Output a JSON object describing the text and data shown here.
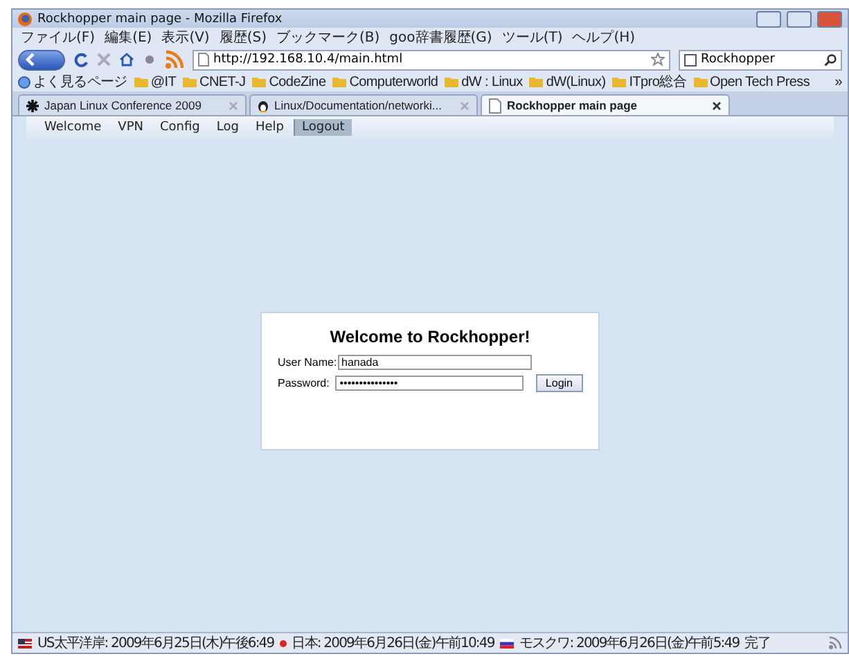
{
  "window": {
    "title": "Rockhopper main page - Mozilla Firefox"
  },
  "menu": [
    "ファイル(F)",
    "編集(E)",
    "表示(V)",
    "履歴(S)",
    "ブックマーク(B)",
    "goo辞書履歴(G)",
    "ツール(T)",
    "ヘルプ(H)"
  ],
  "address": {
    "value": "http://192.168.10.4/main.html"
  },
  "search": {
    "value": "Rockhopper"
  },
  "bookmarks": [
    {
      "label": "よく見るページ",
      "kind": "globe"
    },
    {
      "label": "@IT",
      "kind": "folder"
    },
    {
      "label": "CNET-J",
      "kind": "folder"
    },
    {
      "label": "CodeZine",
      "kind": "folder"
    },
    {
      "label": "Computerworld",
      "kind": "folder"
    },
    {
      "label": "dW : Linux",
      "kind": "folder"
    },
    {
      "label": "dW(Linux)",
      "kind": "folder"
    },
    {
      "label": "ITpro総合",
      "kind": "folder"
    },
    {
      "label": "Open Tech Press",
      "kind": "folder"
    }
  ],
  "more": "»",
  "tabs": [
    {
      "label": "Japan Linux Conference 2009",
      "kind": "star",
      "selected": false
    },
    {
      "label": "Linux/Documentation/networki...",
      "kind": "penguin",
      "selected": false
    },
    {
      "label": "Rockhopper main page",
      "kind": "page",
      "selected": true
    }
  ],
  "nav": [
    {
      "label": "Welcome",
      "selected": false
    },
    {
      "label": "VPN",
      "selected": false
    },
    {
      "label": "Config",
      "selected": false
    },
    {
      "label": "Log",
      "selected": false
    },
    {
      "label": "Help",
      "selected": false
    },
    {
      "label": "Logout",
      "selected": true
    }
  ],
  "login": {
    "title": "Welcome to Rockhopper!",
    "user_label": "User Name:",
    "user_value": "hanada",
    "password_label": "Password:",
    "password_value": "•••••••••••••••",
    "button": "Login"
  },
  "status_bar": [
    {
      "text": "US太平洋岸: 2009年6月25日(木)午後6:49",
      "kind": "us"
    },
    {
      "text": "日本: 2009年6月26日(金)午前10:49",
      "kind": "jp"
    },
    {
      "text": "モスクワ: 2009年6月26日(金)午前5:49",
      "kind": "ru"
    },
    {
      "text": "完了",
      "kind": "plain"
    }
  ]
}
